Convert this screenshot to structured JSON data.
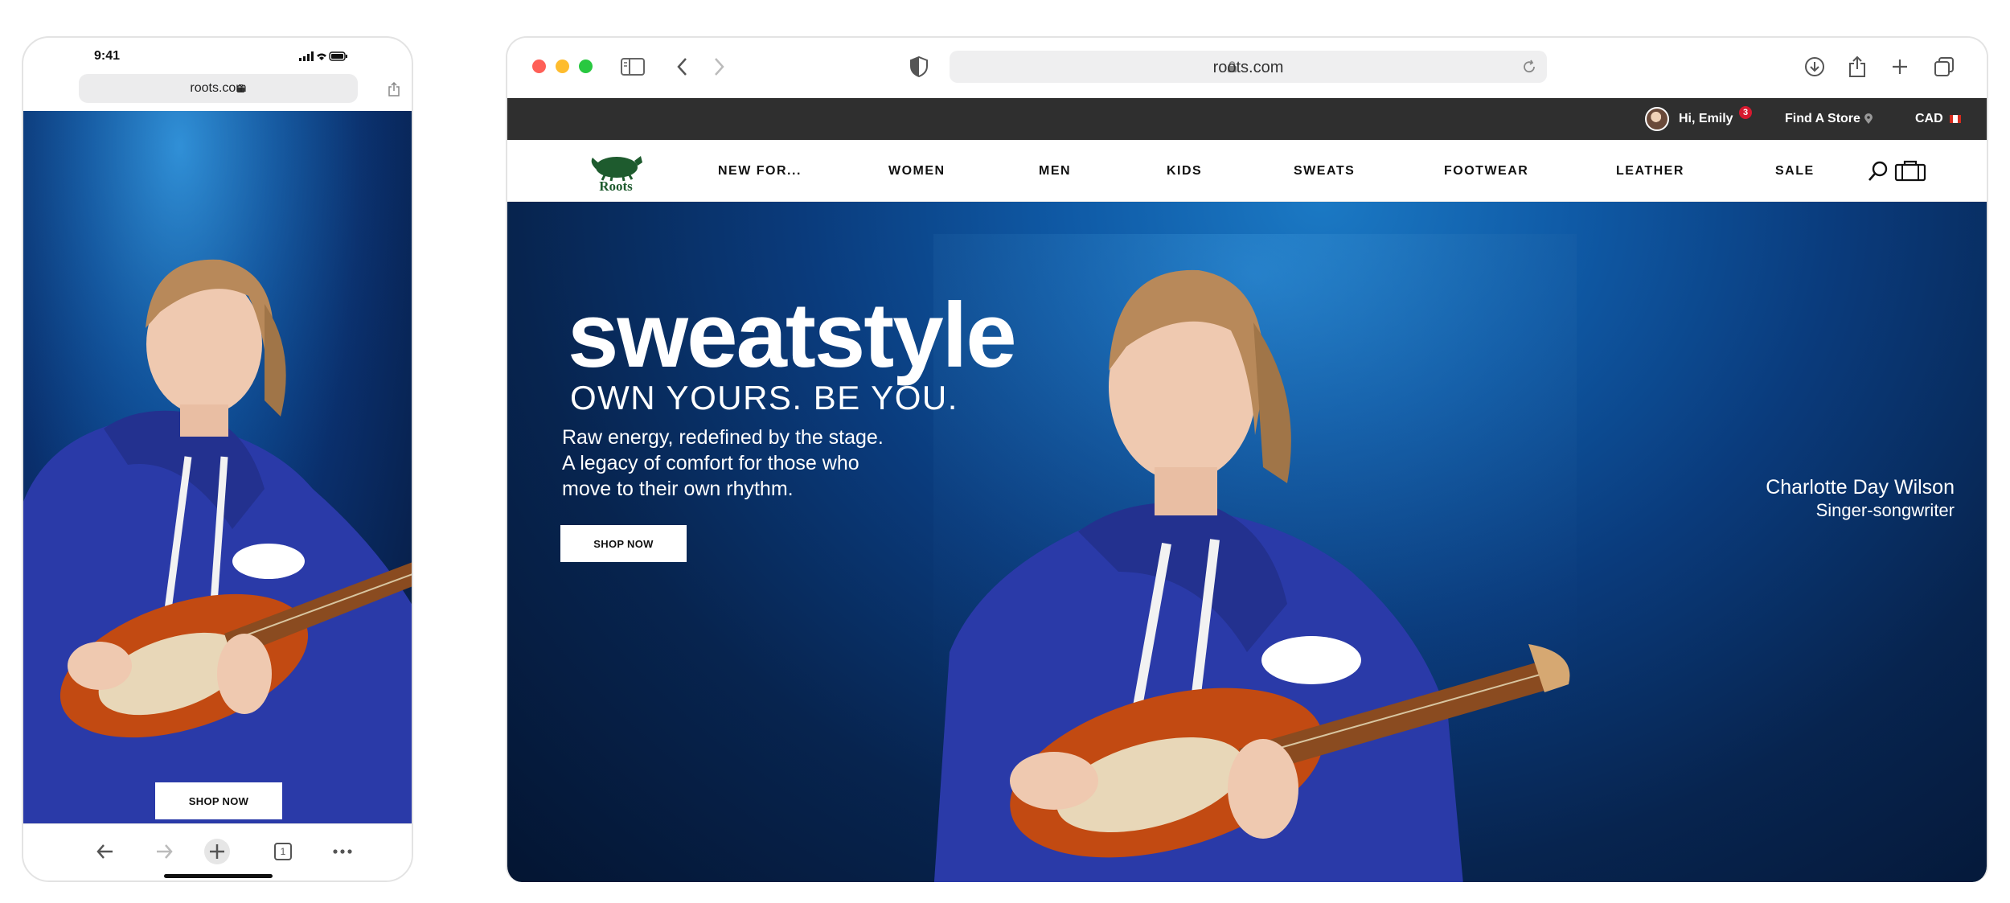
{
  "phone": {
    "time": "9:41",
    "url": "roots.com",
    "shop_now": "SHOP NOW",
    "toolbar": {
      "icons": [
        "back-arrow-icon",
        "forward-arrow-icon",
        "new-tab-plus-icon",
        "tabs-icon",
        "more-icon"
      ],
      "tab_count": "1"
    }
  },
  "browser": {
    "url": "roots.com"
  },
  "utility_bar": {
    "greeting": "Hi, Emily",
    "notification_count": "3",
    "find_store": "Find A Store",
    "currency": "CAD"
  },
  "nav": {
    "logo": "Roots",
    "items": [
      "NEW FOR...",
      "WOMEN",
      "MEN",
      "KIDS",
      "SWEATS",
      "FOOTWEAR",
      "LEATHER",
      "SALE"
    ]
  },
  "hero": {
    "headline": "sweatstyle",
    "tagline": "OWN YOURS. BE YOU.",
    "body_lines": [
      "Raw energy, redefined by the stage.",
      "A legacy of comfort for those who",
      "move to their own rhythm."
    ],
    "cta": "SHOP NOW",
    "credit_name": "Charlotte Day Wilson",
    "credit_role": "Singer-songwriter"
  },
  "colors": {
    "utility_bar_bg": "#2f2f2f",
    "hero_blue": "#0a3b7c",
    "badge_red": "#d7192f",
    "logo_green": "#1e5b2e"
  }
}
